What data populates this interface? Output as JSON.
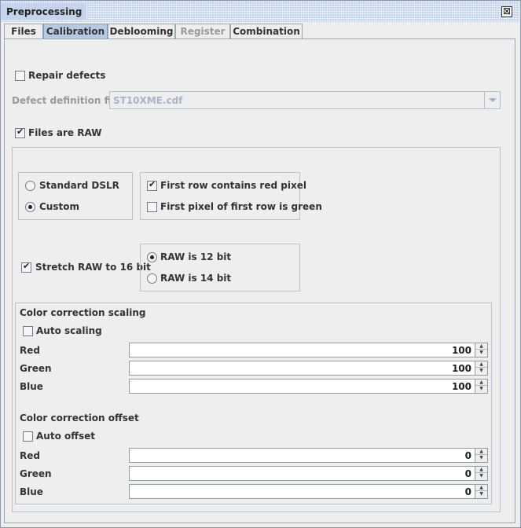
{
  "window": {
    "title": "Preprocessing",
    "close_glyph": "⊠"
  },
  "tabs": [
    {
      "label": "Files"
    },
    {
      "label": "Calibration"
    },
    {
      "label": "Deblooming"
    },
    {
      "label": "Register"
    },
    {
      "label": "Combination"
    }
  ],
  "repair_defects": {
    "label": "Repair defects",
    "checked": false
  },
  "defect_file": {
    "label": "Defect definition file:",
    "value": "ST10XME.cdf"
  },
  "files_are_raw": {
    "label": "Files are RAW",
    "checked": true
  },
  "camera_type": {
    "standard": "Standard DSLR",
    "custom": "Custom",
    "selected": "custom"
  },
  "bayer": {
    "red_first": {
      "label": "First row contains red pixel",
      "checked": true
    },
    "green_first": {
      "label": "First pixel of first row is green",
      "checked": false
    }
  },
  "stretch": {
    "label": "Stretch RAW to 16 bit",
    "checked": true
  },
  "bitdepth": {
    "bit12": "RAW is 12 bit",
    "bit14": "RAW is 14 bit",
    "selected": "12"
  },
  "scaling": {
    "title": "Color correction scaling",
    "auto": {
      "label": "Auto scaling",
      "checked": false
    },
    "red": {
      "label": "Red",
      "value": "100"
    },
    "green": {
      "label": "Green",
      "value": "100"
    },
    "blue": {
      "label": "Blue",
      "value": "100"
    }
  },
  "offset": {
    "title": "Color correction offset",
    "auto": {
      "label": "Auto offset",
      "checked": false
    },
    "red": {
      "label": "Red",
      "value": "0"
    },
    "green": {
      "label": "Green",
      "value": "0"
    },
    "blue": {
      "label": "Blue",
      "value": "0"
    }
  },
  "colors": {
    "accent": "#b7cae3",
    "title_bar": "#c5d4ea",
    "disabled_text": "#9a9a9a"
  },
  "icons": {
    "close": "close-icon",
    "dropdown": "chevron-down-icon",
    "spin_up": "arrow-up-icon",
    "spin_down": "arrow-down-icon"
  }
}
